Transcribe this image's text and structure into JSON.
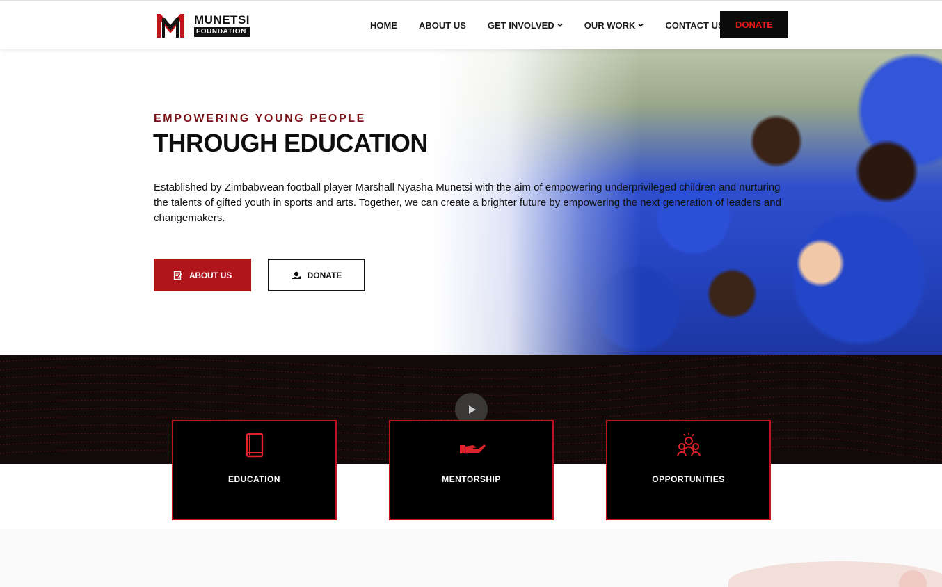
{
  "header": {
    "logo_name": "MUNETSI",
    "logo_sub": "FOUNDATION",
    "nav": [
      {
        "label": "HOME",
        "dropdown": false
      },
      {
        "label": "ABOUT US",
        "dropdown": false
      },
      {
        "label": "GET INVOLVED",
        "dropdown": true
      },
      {
        "label": "OUR WORK",
        "dropdown": true
      },
      {
        "label": "CONTACT US",
        "dropdown": false
      }
    ],
    "donate_label": "DONATE"
  },
  "hero": {
    "eyebrow": "EMPOWERING YOUNG PEOPLE",
    "headline": "THROUGH EDUCATION",
    "intro": "Established by Zimbabwean football player Marshall Nyasha Munetsi with the aim of empowering underprivileged children and nurturing the talents of gifted youth in sports and arts. Together, we can create a brighter future by empowering the next generation of leaders and changemakers.",
    "about_label": "ABOUT US",
    "donate_label": "DONATE"
  },
  "features": [
    {
      "label": "EDUCATION",
      "icon": "book-icon"
    },
    {
      "label": "MENTORSHIP",
      "icon": "hand-icon"
    },
    {
      "label": "OPPORTUNITIES",
      "icon": "people-icon"
    }
  ],
  "colors": {
    "accent": "#b0151b",
    "eyebrow": "#7a0f14",
    "card_border": "#c0141c",
    "donate_text": "#e01b1b"
  }
}
